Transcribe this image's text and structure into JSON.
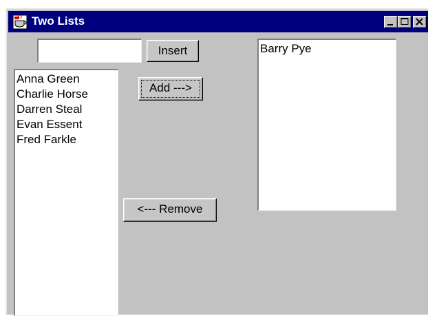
{
  "window": {
    "title": "Two Lists",
    "icon": "java-cup-icon"
  },
  "controls": {
    "minimize_icon": "minimize-icon",
    "maximize_icon": "maximize-icon",
    "close_icon": "close-icon"
  },
  "input": {
    "value": ""
  },
  "buttons": {
    "insert_label": "Insert",
    "add_label": "Add --->",
    "remove_label": "<--- Remove"
  },
  "left_list": {
    "items": [
      "Anna Green",
      "Charlie Horse",
      "Darren Steal",
      "Evan Essent",
      "Fred Farkle"
    ]
  },
  "right_list": {
    "items": [
      "Barry Pye"
    ]
  },
  "colors": {
    "titlebar": "#00007f",
    "window_bg": "#c2c2c2",
    "list_bg": "#ffffff"
  }
}
